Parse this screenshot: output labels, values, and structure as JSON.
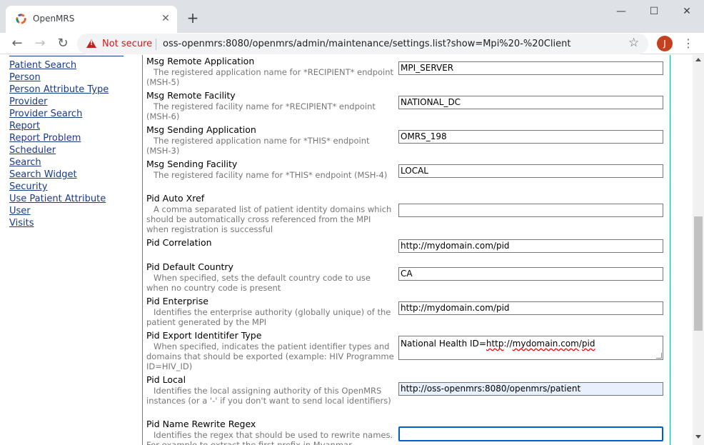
{
  "browser": {
    "tab_title": "OpenMRS",
    "tab_close": "✕",
    "new_tab": "+",
    "minimize": "—",
    "maximize": "☐",
    "close": "✕",
    "security_label": "Not secure",
    "url": "oss-openmrs:8080/openmrs/admin/maintenance/settings.list?show=Mpi%20-%20Client",
    "profile_initial": "J",
    "colors": {
      "tab_strip": "#dee1e6",
      "warning": "#c5221f",
      "avatar": "#c5401f"
    }
  },
  "sidebar": {
    "links": [
      "Patient Search",
      "Person",
      "Person Attribute Type",
      "Provider",
      "Provider Search",
      "Report",
      "Report Problem",
      "Scheduler",
      "Search",
      "Search Widget",
      "Security",
      "Use Patient Attribute",
      "User",
      "Visits"
    ]
  },
  "settings": [
    {
      "name": "Msg Remote Application",
      "description": "The registered application name for *RECIPIENT* endpoint (MSH-5)",
      "value": "MPI_SERVER"
    },
    {
      "name": "Msg Remote Facility",
      "description": "The registered facility name for *RECIPIENT* endpoint (MSH-6)",
      "value": "NATIONAL_DC"
    },
    {
      "name": "Msg Sending Application",
      "description": "The registered application name for *THIS* endpoint (MSH-3)",
      "value": "OMRS_198"
    },
    {
      "name": "Msg Sending Facility",
      "description": "The registered facility name for *THIS* endpoint (MSH-4)",
      "value": "LOCAL"
    },
    {
      "name": "Pid Auto Xref",
      "description": "A comma separated list of patient identity domains which should be automatically cross referenced from the MPI when registration is successful",
      "value": ""
    },
    {
      "name": "Pid Correlation",
      "description": "",
      "value": "http://mydomain.com/pid"
    },
    {
      "name": "Pid Default Country",
      "description": "When specified, sets the default country code to use when no country code is present",
      "value": "CA"
    },
    {
      "name": "Pid Enterprise",
      "description": "Identifies the enterprise authority (globally unique) of the patient generated by the MPI",
      "value": "http://mydomain.com/pid"
    },
    {
      "name": "Pid Export Identitifer Type",
      "description": "When specified, indicates the patient identifier types and domains that should be exported (example: HIV Programme ID=HIV_ID)",
      "value_prefix": "National Health ID=",
      "value_http": "http",
      "value_sep": "://",
      "value_domain": "mydomain.com",
      "value_slash": "/",
      "value_pid": "pid"
    },
    {
      "name": "Pid Local",
      "description": "Identifies the local assigning authority of this OpenMRS instances (or a '-' if you don't want to send local identifiers)",
      "value": "http://oss-openmrs:8080/openmrs/patient"
    },
    {
      "name": "Pid Name Rewrite Regex",
      "description": "Identifies the regex that should be used to rewrite names. For example to extract the first prefix in Myanmar",
      "value": ""
    }
  ]
}
